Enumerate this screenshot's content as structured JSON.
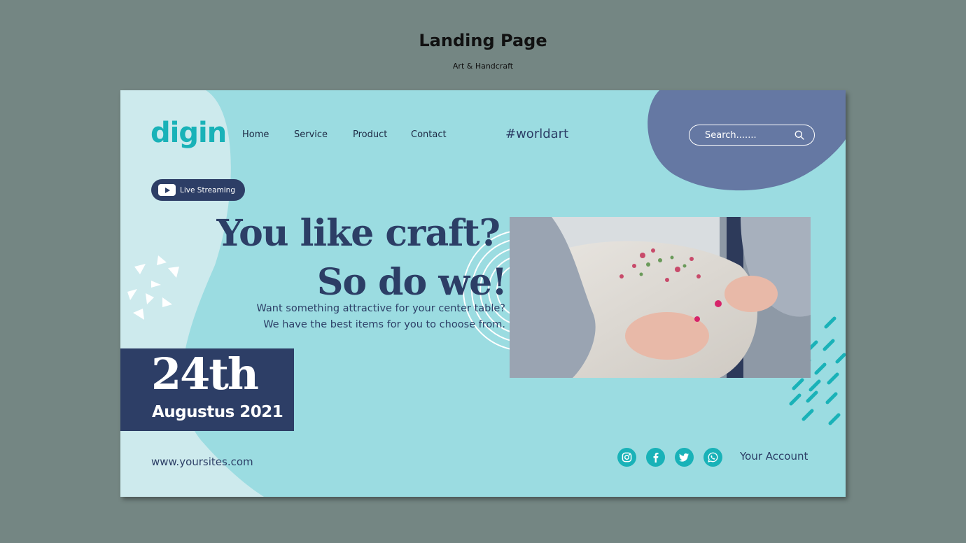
{
  "header": {
    "title": "Landing Page",
    "subtitle": "Art & Handcraft"
  },
  "site": {
    "logo": "digin",
    "nav": [
      {
        "label": "Home"
      },
      {
        "label": "Service"
      },
      {
        "label": "Product"
      },
      {
        "label": "Contact"
      }
    ],
    "hashtag": "#worldart",
    "search": {
      "placeholder": "Search.......",
      "icon": "search-icon"
    },
    "live": {
      "label": "Live Streaming",
      "icon": "youtube-play-icon"
    },
    "hero": {
      "headline_line1": "You like craft?",
      "headline_line2": "So do we!",
      "body_line1": "Want something attractive for your center table?",
      "body_line2": "We have the best items for you to choose from."
    },
    "event": {
      "day": "24th",
      "month_year": "Augustus 2021"
    },
    "website": "www.yoursites.com",
    "social_icons": [
      "instagram-icon",
      "facebook-icon",
      "twitter-icon",
      "whatsapp-icon"
    ],
    "account": "Your Account"
  },
  "colors": {
    "page_bg": "#748683",
    "card_bg": "#9bdce1",
    "light_panel": "#cdeaed",
    "navy": "#2d3e66",
    "blob": "#6578a3",
    "teal": "#19b2b8"
  }
}
